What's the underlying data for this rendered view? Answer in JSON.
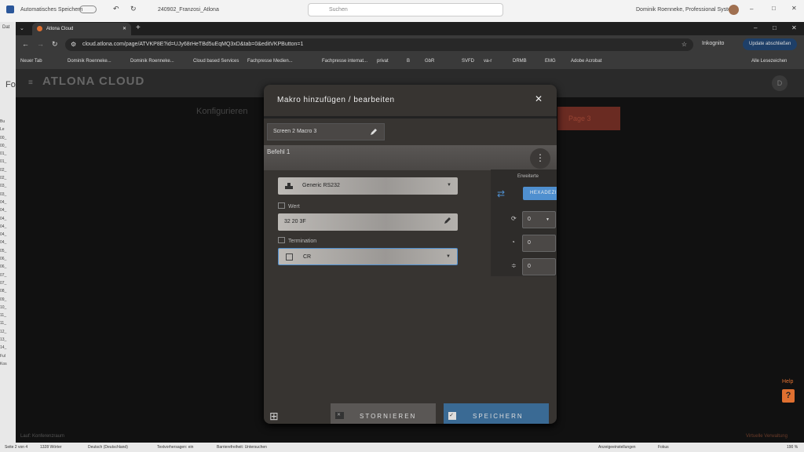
{
  "word": {
    "autosave": "Automatisches Speichern",
    "doc_title": "240902_Franzosi_Atlona",
    "search_placeholder": "Suchen",
    "user": "Dominik Roenneke, Professional System",
    "left_labels": [
      "Dat",
      "Fo"
    ],
    "left_lines": [
      "Bu",
      "Le",
      "00_",
      "00_",
      "01_",
      "01_",
      "02_",
      "02_",
      "03_",
      "03_",
      "04_",
      "04_",
      "04_",
      "04_",
      "04_",
      "04_",
      "05_",
      "06_",
      "06_",
      "07_",
      "07_",
      "08_",
      "09_",
      "10_",
      "11_",
      "11_",
      "12_",
      "13_",
      "14_",
      "Ful",
      "Kos"
    ],
    "status": {
      "page": "Seite 2 von 4",
      "words": "1328 Wörter",
      "lang": "Deutsch (Deutschland)",
      "reader": "Textvorhersagen: ein",
      "access": "Barrierefreiheit: Untersuchen",
      "display": "Anzeigeeinstellungen",
      "focus": "Fokus",
      "zoom": "190 %"
    }
  },
  "chrome": {
    "tab_title": "Atlona Cloud",
    "url": "cloud.atlona.com/page/ATVKP8E?id=UJy68rHeTBd5uEqMQ3xD&tab=0&editVKPButton=1",
    "incognito": "Inkognito",
    "update": "Update abschließen",
    "bookmarks": [
      "Neuer Tab",
      "Dominik Roenneke...",
      "Dominik Roenneke...",
      "Cloud based Services",
      "Fachpresse Medien...",
      "Fachpresse internat...",
      "privat",
      "B",
      "GbR",
      "SVFD",
      "va-r",
      "DRMB",
      "EMG",
      "Adobe Acrobat",
      "Alle Lesezeichen"
    ]
  },
  "app": {
    "logo": "ATLONA CLOUD",
    "avatar": "D",
    "bg_title": "Konfigurieren",
    "bg_red": "Page 3",
    "bg_footer_left": "Lauf: Konferenzraum",
    "bg_footer_right": "Virtuelle Verwaltung",
    "help": "Help",
    "help_icon": "?"
  },
  "modal": {
    "title": "Makro hinzufügen / bearbeiten",
    "close": "✕",
    "macro_name": "Screen 2 Macro 3",
    "command_title": "Befehl 1",
    "device": "Generic RS232",
    "value_label": "Wert",
    "value": "32 20 3F",
    "termination_label": "Termination",
    "termination": "CR",
    "advanced": {
      "title": "Erweiterte",
      "format": "HEXADEZI",
      "repeat": "0",
      "delay": "0",
      "spacing": "0"
    },
    "cancel": "STORNIEREN",
    "save": "SPEICHERN"
  },
  "colors": {
    "accent": "#4f8fcf",
    "save": "#3a6a94",
    "help": "#e07030"
  }
}
